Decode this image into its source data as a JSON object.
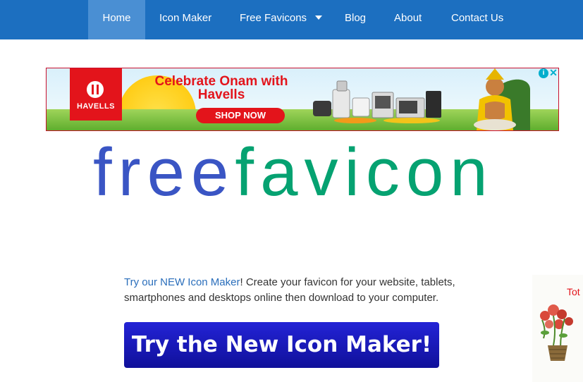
{
  "nav": {
    "items": [
      {
        "label": "Home",
        "active": true
      },
      {
        "label": "Icon Maker"
      },
      {
        "label": "Free Favicons",
        "has_dropdown": true
      },
      {
        "label": "Blog"
      },
      {
        "label": "About"
      },
      {
        "label": "Contact Us"
      }
    ],
    "colors": {
      "bar": "#1c6fc0",
      "active": "#4a8fd3"
    }
  },
  "ad": {
    "brand": "HAVELLS",
    "headline": "Celebrate Onam with Havells",
    "cta": "SHOP NOW",
    "info_icon": "info-icon",
    "close_icon": "close-icon"
  },
  "logo": {
    "part1": "free",
    "part2": "favicon",
    "colors": {
      "part1": "#3a55c4",
      "part2": "#05a271"
    }
  },
  "intro": {
    "link_text": "Try our NEW Icon Maker",
    "text": "! Create your favicon for your website, tablets, smartphones and desktops online then download to your computer."
  },
  "cta": {
    "label": "Try the New Icon Maker!"
  },
  "side_ad": {
    "text": "Tot"
  }
}
